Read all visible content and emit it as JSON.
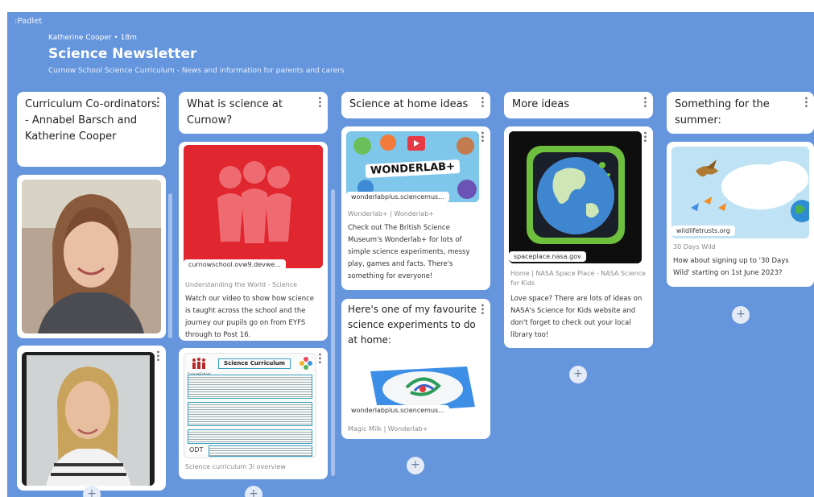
{
  "brand": ":Padlet",
  "header": {
    "author": "Katherine Cooper",
    "time": "18m",
    "title": "Science Newsletter",
    "subtitle": "Curnow School Science Curriculum - News and information for parents and carers"
  },
  "columns": [
    {
      "heading": "Curriculum Co-ordinators - Annabel Barsch and Katherine Cooper"
    },
    {
      "heading": "What is science at Curnow?",
      "post1": {
        "url": "curnowschool.ovw9.devwe...",
        "source": "Understanding the World - Science",
        "text": "Watch our video to show how science is taught across the school and the journey our pupils go on from EYFS through to Post 16."
      },
      "post2": {
        "doc_logo": "CurnowSchool",
        "doc_title": "Science Curriculum",
        "file_type": "ODT",
        "caption": "Science curriculum 3i overview"
      }
    },
    {
      "heading": "Science at home ideas",
      "post1": {
        "image_text": "WONDERLAB+",
        "url": "wonderlabplus.sciencemus...",
        "source": "Wonderlab+ | Wonderlab+",
        "text": "Check out The British Science Museum's Wonderlab+ for lots of simple science experiments, messy play, games and facts. There's something for everyone!"
      },
      "post2": {
        "title": "Here's one of my favourite science experiments to do at home:",
        "url": "wonderlabplus.sciencemus...",
        "source": "Magic Milk | Wonderlab+"
      }
    },
    {
      "heading": "More ideas",
      "post1": {
        "url": "spaceplace.nasa.gov",
        "source": "Home | NASA Space Place - NASA Science for Kids",
        "text": "Love space? There are lots of ideas on NASA's Science for Kids website and don't forget to check out your local library too!"
      }
    },
    {
      "heading": "Something for the summer:",
      "post1": {
        "url": "wildlifetrusts.org",
        "source": "30 Days Wild",
        "text": "How about signing up to '30 Days Wild' starting on 1st June 2023?"
      }
    }
  ],
  "add_label": "+",
  "colors": {
    "board": "#6595dc",
    "card": "#ffffff",
    "red": "#e0262f"
  }
}
